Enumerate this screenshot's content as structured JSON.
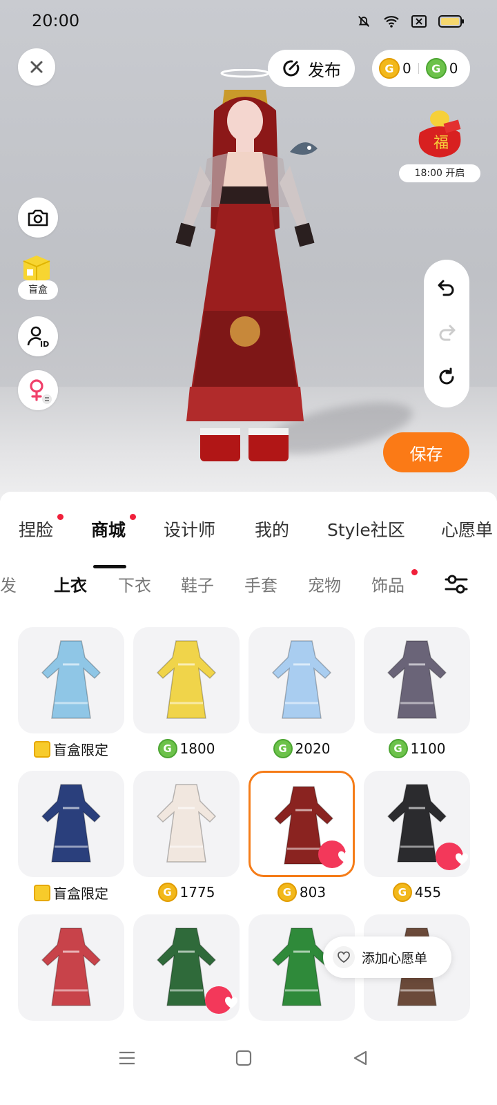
{
  "status_bar": {
    "time": "20:00",
    "icons": [
      "bell-off-icon",
      "wifi-icon",
      "sim-x-icon",
      "battery-icon"
    ]
  },
  "toolbar": {
    "publish_label": "发布",
    "gold_coins": "0",
    "green_coins": "0"
  },
  "fortune": {
    "badge_char": "福",
    "label": "18:00 开启"
  },
  "left_tools": {
    "blind_box_label": "盲盒"
  },
  "save_label": "保存",
  "main_tabs": [
    {
      "label": "捏脸",
      "dot": true
    },
    {
      "label": "商城",
      "dot": true,
      "active": true
    },
    {
      "label": "设计师"
    },
    {
      "label": "我的"
    },
    {
      "label": "Style社区"
    },
    {
      "label": "心愿单"
    }
  ],
  "sub_tabs": [
    {
      "label": "头发"
    },
    {
      "label": "上衣",
      "active": true
    },
    {
      "label": "下衣"
    },
    {
      "label": "鞋子"
    },
    {
      "label": "手套"
    },
    {
      "label": "宠物"
    },
    {
      "label": "饰品",
      "dot": true
    }
  ],
  "items": [
    {
      "price_type": "blindbox",
      "price": "盲盒限定",
      "color": "#8fc6e6"
    },
    {
      "price_type": "green",
      "price": "1800",
      "color": "#f0d44a"
    },
    {
      "price_type": "green",
      "price": "2020",
      "color": "#a9cdf0"
    },
    {
      "price_type": "green",
      "price": "1100",
      "color": "#6a6478"
    },
    {
      "price_type": "blindbox",
      "price": "盲盒限定",
      "color": "#2a3f7c"
    },
    {
      "price_type": "gold",
      "price": "1775",
      "color": "#f1e7df"
    },
    {
      "price_type": "gold",
      "price": "803",
      "color": "#8a2320",
      "selected": true,
      "liked": true
    },
    {
      "price_type": "gold",
      "price": "455",
      "color": "#2b2b2e",
      "liked": true
    },
    {
      "color": "#c8434a"
    },
    {
      "color": "#2f6a3a",
      "liked": true
    },
    {
      "color": "#2f8a3a"
    },
    {
      "color": "#6b4a3a"
    }
  ],
  "wish_tip": "添加心愿单",
  "colors": {
    "accent": "#fb7a16",
    "red_dot": "#f0203a",
    "heart": "#f3385a",
    "gold_coin": "#f2b81b",
    "green_coin": "#6cc24a"
  }
}
